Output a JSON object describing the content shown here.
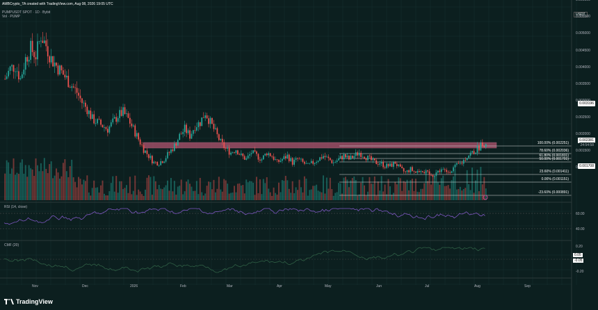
{
  "header": {
    "author_line": "AMBCrypto_TA created with TradingView.com, Aug 08, 2026 19:05 UTC",
    "symbol_line": "PUMPUSDT SPOT · 1D · Bybit",
    "volume_line": "Vol · PUMP"
  },
  "colors": {
    "background": "#0c1f1f",
    "up_candle": "#26a69a",
    "down_candle": "#ef5350",
    "rsi_line": "#7e57c2",
    "cmf_line": "#2f5f45",
    "zone": "#b05470",
    "fib_line": "#e0e0e0"
  },
  "right_axis": {
    "currency": "USDT",
    "labels": [
      "0.006000",
      "0.005500",
      "0.005000",
      "0.004500",
      "0.004000",
      "0.003500",
      "0.003000",
      "0.002500",
      "0.002000",
      "0.001500",
      "0.001000"
    ]
  },
  "price_tags": {
    "level_high": "0.003196",
    "current_price": "0.002381",
    "countdown": "24:54:58",
    "support": "0.001708"
  },
  "fib_levels": [
    {
      "label": "100.00% (0.002251)"
    },
    {
      "label": "78.60% (0.002036)"
    },
    {
      "label": "61.80% (0.001831)"
    },
    {
      "label": "50.00% (0.001701)"
    },
    {
      "label": "23.60% (0.001411)"
    },
    {
      "label": "0.00% (0.001151)"
    },
    {
      "label": "-23.60% (0.000891)"
    }
  ],
  "rsi": {
    "title": "RSI (14, close)",
    "axis": [
      "60.00",
      "40.00"
    ]
  },
  "cmf": {
    "title": "CMF (20)",
    "axis": [
      "0.20",
      "0.00",
      "-0.20"
    ],
    "tag_a": "0.05",
    "tag_b": "-0.05"
  },
  "x_axis": [
    "Nov",
    "Dec",
    "2026",
    "Feb",
    "Mar",
    "Apr",
    "May",
    "Jun",
    "Jul",
    "Aug",
    "Sep"
  ],
  "branding": {
    "name": "TradingView"
  },
  "chart_data": {
    "type": "candlestick",
    "title": "PUMPUSDT SPOT · 1D · Bybit",
    "x_categories": [
      "Nov",
      "Dec",
      "2026",
      "Feb",
      "Mar",
      "Apr",
      "May",
      "Jun",
      "Jul",
      "Aug",
      "Sep"
    ],
    "y_range": [
      0.0008,
      0.0062
    ],
    "close_path": [
      [
        0,
        0.0043
      ],
      [
        3,
        0.0046
      ],
      [
        6,
        0.0047
      ],
      [
        9,
        0.0043
      ],
      [
        12,
        0.0049
      ],
      [
        15,
        0.0052
      ],
      [
        18,
        0.005
      ],
      [
        21,
        0.0056
      ],
      [
        24,
        0.0053
      ],
      [
        27,
        0.0049
      ],
      [
        30,
        0.0047
      ],
      [
        33,
        0.0045
      ],
      [
        36,
        0.0043
      ],
      [
        39,
        0.0041
      ],
      [
        42,
        0.0039
      ],
      [
        45,
        0.0036
      ],
      [
        48,
        0.0034
      ],
      [
        51,
        0.0031
      ],
      [
        54,
        0.003
      ],
      [
        57,
        0.0029
      ],
      [
        60,
        0.0028
      ],
      [
        63,
        0.003
      ],
      [
        66,
        0.0032
      ],
      [
        69,
        0.0033
      ],
      [
        72,
        0.0031
      ],
      [
        75,
        0.0028
      ],
      [
        78,
        0.0025
      ],
      [
        81,
        0.0022
      ],
      [
        84,
        0.002
      ],
      [
        87,
        0.0018
      ],
      [
        90,
        0.0018
      ],
      [
        93,
        0.0019
      ],
      [
        96,
        0.0021
      ],
      [
        99,
        0.0023
      ],
      [
        102,
        0.0026
      ],
      [
        105,
        0.0028
      ],
      [
        108,
        0.0026
      ],
      [
        111,
        0.0029
      ],
      [
        114,
        0.003
      ],
      [
        117,
        0.0033
      ],
      [
        120,
        0.003
      ],
      [
        123,
        0.0027
      ],
      [
        126,
        0.0024
      ],
      [
        129,
        0.0022
      ],
      [
        132,
        0.0021
      ],
      [
        135,
        0.0022
      ],
      [
        138,
        0.002
      ],
      [
        141,
        0.0019
      ],
      [
        144,
        0.0021
      ],
      [
        147,
        0.002
      ],
      [
        150,
        0.0019
      ],
      [
        153,
        0.0021
      ],
      [
        156,
        0.002
      ],
      [
        159,
        0.0018
      ],
      [
        162,
        0.0019
      ],
      [
        165,
        0.002
      ],
      [
        168,
        0.0018
      ],
      [
        171,
        0.0019
      ],
      [
        174,
        0.0018
      ],
      [
        177,
        0.0017
      ],
      [
        180,
        0.0018
      ],
      [
        183,
        0.0019
      ],
      [
        186,
        0.002
      ],
      [
        189,
        0.0019
      ],
      [
        192,
        0.0018
      ],
      [
        195,
        0.0019
      ],
      [
        198,
        0.002
      ],
      [
        201,
        0.0019
      ],
      [
        204,
        0.002
      ],
      [
        207,
        0.0021
      ],
      [
        210,
        0.002
      ],
      [
        213,
        0.0019
      ],
      [
        216,
        0.0018
      ],
      [
        219,
        0.0018
      ],
      [
        222,
        0.0017
      ],
      [
        225,
        0.0017
      ],
      [
        228,
        0.0018
      ],
      [
        231,
        0.0016
      ],
      [
        234,
        0.0015
      ],
      [
        237,
        0.0016
      ],
      [
        240,
        0.0015
      ],
      [
        243,
        0.0016
      ],
      [
        246,
        0.0015
      ],
      [
        249,
        0.0014
      ],
      [
        252,
        0.0015
      ],
      [
        255,
        0.0016
      ],
      [
        258,
        0.0015
      ],
      [
        261,
        0.0016
      ],
      [
        264,
        0.0017
      ],
      [
        267,
        0.0018
      ],
      [
        270,
        0.002
      ],
      [
        273,
        0.0021
      ],
      [
        276,
        0.0022
      ],
      [
        279,
        0.0024
      ],
      [
        282,
        0.0023
      ]
    ]
  }
}
